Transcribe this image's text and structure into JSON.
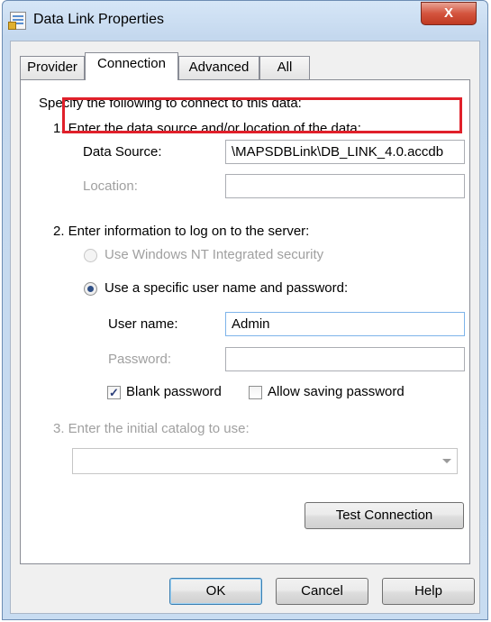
{
  "window": {
    "title": "Data Link Properties",
    "close_glyph": "X"
  },
  "tabs": [
    {
      "label": "Provider",
      "active": false
    },
    {
      "label": "Connection",
      "active": true
    },
    {
      "label": "Advanced",
      "active": false
    },
    {
      "label": "All",
      "active": false
    }
  ],
  "connection": {
    "intro": "Specify the following to connect to this data:",
    "step1": {
      "heading": "1. Enter the data source and/or location of the data:",
      "data_source_label": "Data Source:",
      "data_source_value": "\\MAPSDBLink\\DB_LINK_4.0.accdb",
      "location_label": "Location:",
      "location_value": ""
    },
    "step2": {
      "heading": "2. Enter information to log on to the server:",
      "nt_security_label": "Use Windows NT Integrated security",
      "nt_security_selected": false,
      "specific_user_label": "Use a specific user name and password:",
      "specific_user_selected": true,
      "username_label": "User name:",
      "username_value": "Admin",
      "password_label": "Password:",
      "password_value": "",
      "blank_password_label": "Blank password",
      "blank_password_checked": true,
      "allow_saving_label": "Allow saving password",
      "allow_saving_checked": false,
      "check_glyph": "✓"
    },
    "step3": {
      "heading": "3. Enter the initial catalog to use:",
      "catalog_value": ""
    },
    "test_connection_label": "Test Connection"
  },
  "buttons": {
    "ok": "OK",
    "cancel": "Cancel",
    "help": "Help"
  },
  "colors": {
    "highlight_box": "#e0202a",
    "close_button": "#d4543e",
    "disabled_text": "#a0a0a0"
  }
}
